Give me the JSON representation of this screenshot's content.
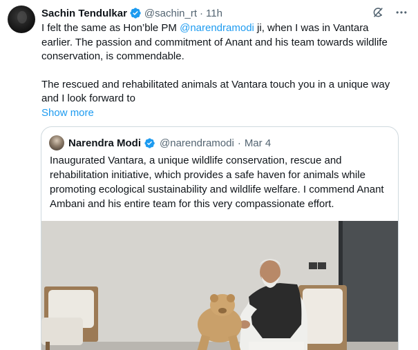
{
  "tweet": {
    "author_name": "Sachin Tendulkar",
    "author_handle": "@sachin_rt",
    "separator": "·",
    "time": "11h",
    "text_line1_prefix": "I felt the same as Hon’ble PM ",
    "mention": "@narendramodi",
    "text_line1_suffix": " ji, when I was in Vantara earlier. The passion and commitment of Anant and his team towards wildlife conservation, is commendable.",
    "text_para2": "The rescued and rehabilitated animals at Vantara touch you in a unique way and I look forward to",
    "show_more": "Show more",
    "header_icons": [
      "grok-icon",
      "more-icon"
    ]
  },
  "quote": {
    "author_name": "Narendra Modi",
    "author_handle": "@narendramodi",
    "separator": "·",
    "date": "Mar 4",
    "text": "Inaugurated Vantara, a unique wildlife conservation, rescue and rehabilitation initiative, which provides a safe haven for animals while promoting ecological sustainability and wildlife welfare. I commend Anant Ambani and his entire team for this very compassionate effort."
  },
  "colors": {
    "accent": "#1d9bf0",
    "secondary_text": "#536471",
    "border": "#cfd9de",
    "verified": "#1d9bf0"
  }
}
